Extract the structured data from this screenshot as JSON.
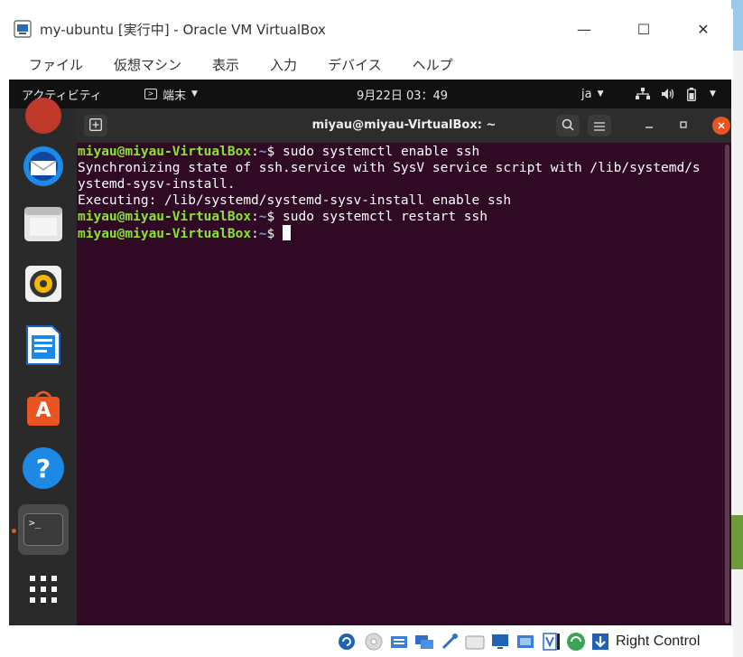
{
  "window": {
    "title": "my-ubuntu [実行中] - Oracle VM VirtualBox",
    "minimize_glyph": "—",
    "maximize_glyph": "☐",
    "close_glyph": "✕"
  },
  "vbox_menu": [
    "ファイル",
    "仮想マシン",
    "表示",
    "入力",
    "デバイス",
    "ヘルプ"
  ],
  "gnome_topbar": {
    "activities": "アクティビティ",
    "app_menu": "端末",
    "clock": "9月22日  03：49",
    "input_method": "ja"
  },
  "dock": {
    "apps": [
      {
        "name": "thunderbird",
        "icon": "mail-icon"
      },
      {
        "name": "files",
        "icon": "folder-icon"
      },
      {
        "name": "rhythmbox",
        "icon": "speaker-icon"
      },
      {
        "name": "writer",
        "icon": "document-icon"
      },
      {
        "name": "software",
        "icon": "shopping-bag-icon"
      },
      {
        "name": "help",
        "icon": "help-icon"
      },
      {
        "name": "terminal",
        "icon": "terminal-icon"
      }
    ],
    "show_apps_icon": "grid-icon",
    "terminal_icon_label": ">_",
    "help_icon_label": "?",
    "software_icon_label": "A"
  },
  "terminal": {
    "title": "miyau@miyau-VirtualBox: ~",
    "lines": [
      {
        "type": "prompt",
        "user": "miyau@miyau-VirtualBox",
        "sep": ":",
        "path": "~",
        "dollar": "$ ",
        "command": "sudo systemctl enable ssh"
      },
      {
        "type": "output",
        "text": "Synchronizing state of ssh.service with SysV service script with /lib/systemd/s"
      },
      {
        "type": "output",
        "text": "ystemd-sysv-install."
      },
      {
        "type": "output",
        "text": "Executing: /lib/systemd/systemd-sysv-install enable ssh"
      },
      {
        "type": "prompt",
        "user": "miyau@miyau-VirtualBox",
        "sep": ":",
        "path": "~",
        "dollar": "$ ",
        "command": "sudo systemctl restart ssh"
      },
      {
        "type": "prompt",
        "user": "miyau@miyau-VirtualBox",
        "sep": ":",
        "path": "~",
        "dollar": "$ ",
        "command": ""
      }
    ]
  },
  "status_bar": {
    "host_key": "Right Control"
  },
  "colors": {
    "terminal_bg": "#300a24",
    "prompt_user": "#8ae234",
    "prompt_path": "#729fcf",
    "accent": "#e95420"
  }
}
